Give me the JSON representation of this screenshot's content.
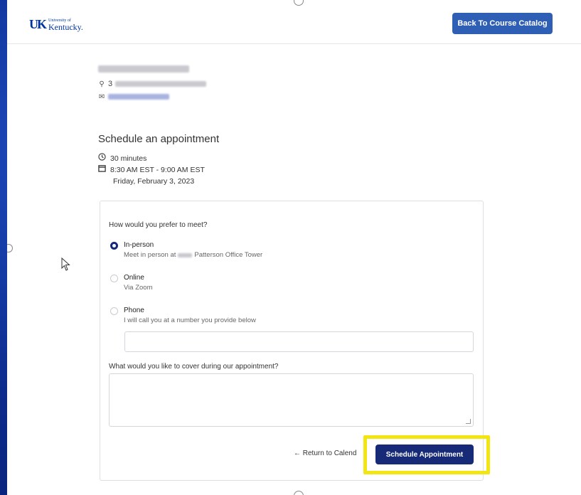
{
  "header": {
    "logo_small": "University of",
    "logo_big": "Kentucky.",
    "back_button_label": "Back To Course Catalog"
  },
  "instructor": {
    "room_prefix": "3"
  },
  "schedule": {
    "title": "Schedule an appointment",
    "duration": "30 minutes",
    "time_range": "8:30 AM EST - 9:00 AM EST",
    "date": "Friday, February 3, 2023"
  },
  "form": {
    "meet_question": "How would you prefer to meet?",
    "options": [
      {
        "title": "In-person",
        "subtitle_prefix": "Meet in person at",
        "subtitle_suffix": "Patterson Office Tower",
        "selected": true
      },
      {
        "title": "Online",
        "subtitle": "Via Zoom",
        "selected": false
      },
      {
        "title": "Phone",
        "subtitle": "I will call you at a number you provide below",
        "selected": false
      }
    ],
    "phone_value": "",
    "cover_question": "What would you like to cover during our appointment?",
    "cover_value": "",
    "return_link": "← Return to Calend",
    "submit_label": "Schedule Appointment"
  },
  "colors": {
    "accent": "#2f5fb5",
    "primary_button": "#162a78",
    "highlight": "#f2e512"
  }
}
